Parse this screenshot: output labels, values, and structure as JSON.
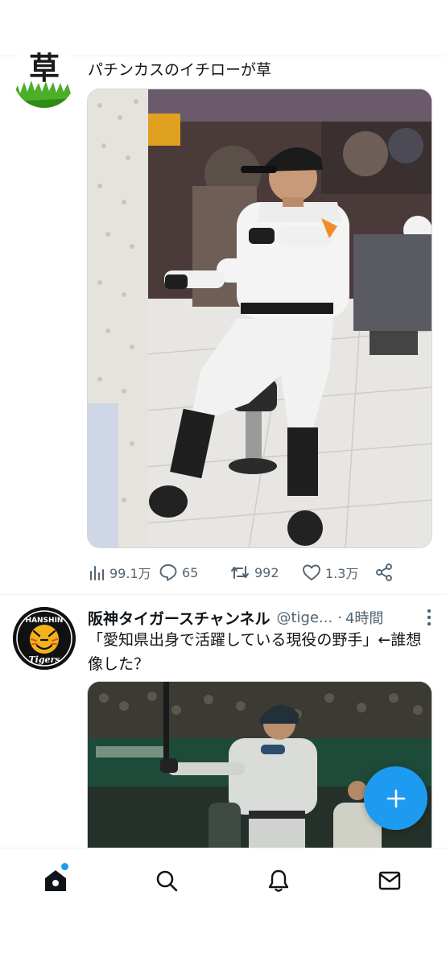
{
  "tweets": [
    {
      "avatar_icon": "grass-kusa-avatar",
      "avatar_text": "草",
      "text": "パチンカスのイチローが草",
      "media_icon": "photo-player-at-pachinko-parlor",
      "stats": {
        "views": "99.1万",
        "replies": "65",
        "retweets": "992",
        "likes": "1.3万"
      }
    },
    {
      "avatar_icon": "hanshin-tigers-logo",
      "avatar_text_top": "HANSHIN",
      "avatar_text_bottom": "Tigers",
      "display_name": "阪神タイガースチャンネル",
      "handle": "@tige...",
      "dot": "·",
      "time": "4時間",
      "text": "「愛知県出身で活躍している現役の野手」←誰想像した？",
      "media_icon": "photo-batter-at-stadium"
    }
  ],
  "fab": {
    "icon": "plus-icon"
  },
  "bottom_nav": [
    {
      "name": "home",
      "icon": "home-icon",
      "has_dot": true
    },
    {
      "name": "search",
      "icon": "search-icon"
    },
    {
      "name": "notifications",
      "icon": "bell-icon"
    },
    {
      "name": "messages",
      "icon": "mail-icon"
    }
  ],
  "colors": {
    "accent": "#1d9bf0",
    "text_primary": "#0f1419",
    "text_secondary": "#536471",
    "divider": "#eff3f4"
  }
}
